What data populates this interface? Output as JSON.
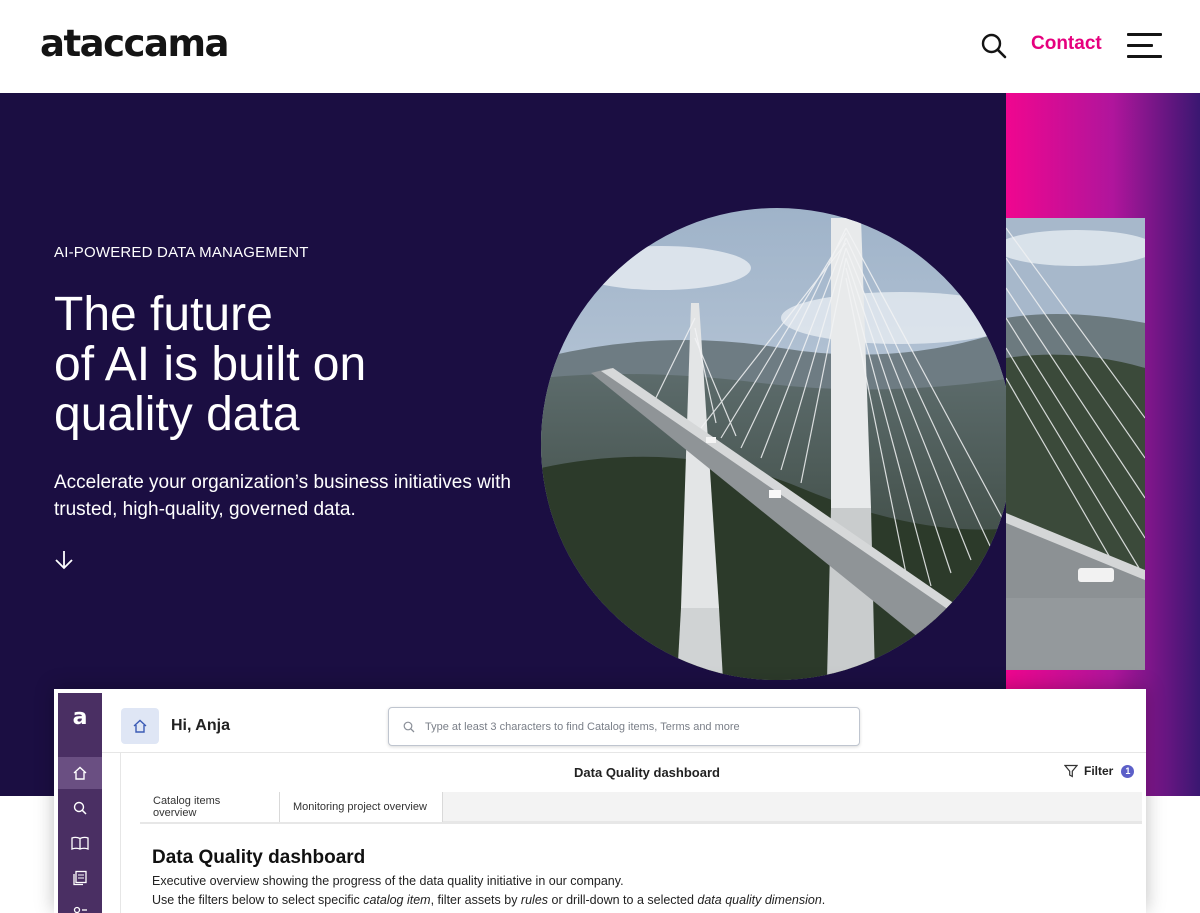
{
  "nav": {
    "logo": "ataccama",
    "contact_label": "Contact",
    "search_icon": "search-icon",
    "menu_icon": "hamburger-menu-icon"
  },
  "hero": {
    "eyebrow": "AI-POWERED DATA MANAGEMENT",
    "title_lines": [
      "The future",
      "of AI is built on",
      "quality data"
    ],
    "subtitle": "Accelerate your organization’s business initiatives with trusted, high-quality, governed data.",
    "scroll_icon": "arrow-down-icon",
    "colors": {
      "background": "#1b0e42",
      "accent": "#e6007e"
    }
  },
  "dashboard": {
    "logo": "a",
    "greeting": "Hi, Anja",
    "search_placeholder": "Type at least 3 characters to find Catalog items, Terms and more",
    "title": "Data Quality dashboard",
    "filter_label": "Filter",
    "filter_count": "1",
    "tabs": [
      {
        "label": "Catalog items overview"
      },
      {
        "label": "Monitoring project overview"
      }
    ],
    "heading": "Data Quality dashboard",
    "description_1": "Executive overview showing the progress of the data quality initiative in our company.",
    "description_2": {
      "p1": "Use the filters below to select specific ",
      "p2": "catalog item",
      "p3": ", filter assets by ",
      "p4": "rules",
      "p5": " or drill-down to a selected ",
      "p6": "data quality dimension",
      "p7": "."
    },
    "sidebar_icons": [
      "home-icon",
      "search-icon",
      "book-icon",
      "documents-icon",
      "settings-icon"
    ]
  }
}
